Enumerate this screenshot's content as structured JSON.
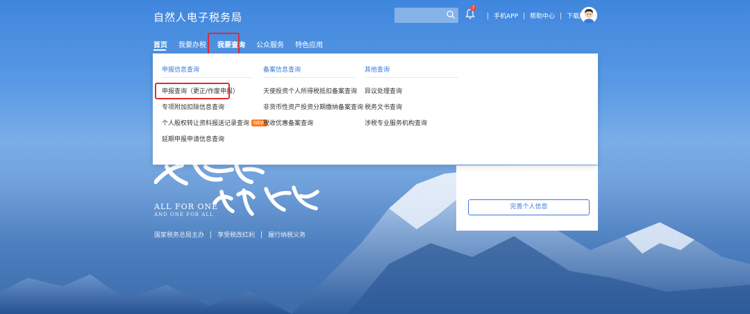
{
  "header": {
    "title": "自然人电子税务局",
    "notification_count": "7",
    "links": [
      "手机APP",
      "帮助中心",
      "下载服务"
    ]
  },
  "nav": {
    "items": [
      "首页",
      "我要办税",
      "我要查询",
      "公众服务",
      "特色应用"
    ],
    "active": "首页",
    "selected": "我要查询"
  },
  "dropdown": {
    "columns": [
      {
        "title": "申报信息查询",
        "items": [
          "申报查询（更正/作废申报）",
          "专项附加扣除信息查询",
          "个人股权转让资料报送记录查询",
          "延期申报申请信息查询"
        ],
        "badge_item_index": 2,
        "badge": "NEW"
      },
      {
        "title": "备案信息查询",
        "items": [
          "天使投资个人所得税抵扣备案查询",
          "非货币性资产投资分期缴纳备案查询",
          "税收优惠备案查询"
        ]
      },
      {
        "title": "其他查询",
        "items": [
          "异议处理查询",
          "税务文书查询",
          "涉税专业服务机构查询"
        ]
      }
    ]
  },
  "side_card": {
    "button_label": "完善个人信息"
  },
  "slogan": {
    "en_line1": "ALL FOR ONE",
    "en_line2": "AND ONE FOR ALL",
    "cn_calligraphy_2": "我为人人",
    "cn_parts": [
      "国家税务总局主办",
      "享受税改红利",
      "履行纳税义务"
    ]
  },
  "colors": {
    "accent": "#3a78d8",
    "highlight_box": "#e22b2b",
    "new_badge": "#ff7a1a"
  },
  "icons": [
    "search-icon",
    "bell-icon",
    "avatar"
  ]
}
